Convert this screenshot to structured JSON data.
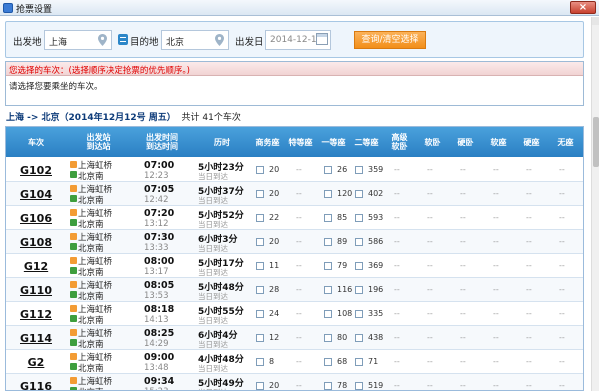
{
  "window": {
    "title": "抢票设置",
    "close_label": "×"
  },
  "query": {
    "from_label": "出发地",
    "from_value": "上海",
    "to_label": "目的地",
    "to_value": "北京",
    "date_label": "出发日",
    "date_value": "2014-12-12",
    "button_label": "查询/清空选择"
  },
  "selected": {
    "header": "您选择的车次：(选择顺序决定抢票的优先顺序。)",
    "prompt": "请选择您要乘坐的车次。"
  },
  "route": {
    "summary": "上海 -> 北京（2014年12月12号 周五）",
    "count_prefix": "共计",
    "count": "41个车次"
  },
  "table": {
    "headers": {
      "train": "车次",
      "station": "出发站\n到达站",
      "time": "出发时间\n到达时间",
      "duration": "历时",
      "business": "商务座",
      "premium": "特等座",
      "first": "一等座",
      "second": "二等座",
      "adv_soft": "高级\n软卧",
      "soft_sleeper": "软卧",
      "hard_sleeper": "硬卧",
      "soft_seat": "软座",
      "hard_seat": "硬座",
      "no_seat": "无座"
    },
    "rows": [
      {
        "train": "G102",
        "from": "上海虹桥",
        "to": "北京南",
        "dep": "07:00",
        "arr": "12:23",
        "dur": "5小时23分",
        "arrday": "当日到达",
        "business": "20",
        "first": "26",
        "second": "359"
      },
      {
        "train": "G104",
        "from": "上海虹桥",
        "to": "北京南",
        "dep": "07:05",
        "arr": "12:42",
        "dur": "5小时37分",
        "arrday": "当日到达",
        "business": "20",
        "first": "120",
        "second": "402"
      },
      {
        "train": "G106",
        "from": "上海虹桥",
        "to": "北京南",
        "dep": "07:20",
        "arr": "13:12",
        "dur": "5小时52分",
        "arrday": "当日到达",
        "business": "22",
        "first": "85",
        "second": "593"
      },
      {
        "train": "G108",
        "from": "上海虹桥",
        "to": "北京南",
        "dep": "07:30",
        "arr": "13:33",
        "dur": "6小时3分",
        "arrday": "当日到达",
        "business": "20",
        "first": "89",
        "second": "586"
      },
      {
        "train": "G12",
        "from": "上海虹桥",
        "to": "北京南",
        "dep": "08:00",
        "arr": "13:17",
        "dur": "5小时17分",
        "arrday": "当日到达",
        "business": "11",
        "first": "79",
        "second": "369"
      },
      {
        "train": "G110",
        "from": "上海虹桥",
        "to": "北京南",
        "dep": "08:05",
        "arr": "13:53",
        "dur": "5小时48分",
        "arrday": "当日到达",
        "business": "28",
        "first": "116",
        "second": "196"
      },
      {
        "train": "G112",
        "from": "上海虹桥",
        "to": "北京南",
        "dep": "08:18",
        "arr": "14:13",
        "dur": "5小时55分",
        "arrday": "当日到达",
        "business": "24",
        "first": "108",
        "second": "335"
      },
      {
        "train": "G114",
        "from": "上海虹桥",
        "to": "北京南",
        "dep": "08:25",
        "arr": "14:29",
        "dur": "6小时4分",
        "arrday": "当日到达",
        "business": "12",
        "first": "80",
        "second": "438"
      },
      {
        "train": "G2",
        "from": "上海虹桥",
        "to": "北京南",
        "dep": "09:00",
        "arr": "13:48",
        "dur": "4小时48分",
        "arrday": "当日到达",
        "business": "8",
        "first": "68",
        "second": "71"
      },
      {
        "train": "G116",
        "from": "上海虹桥",
        "to": "北京南",
        "dep": "09:34",
        "arr": "15:23",
        "dur": "5小时49分",
        "arrday": "当日到达",
        "business": "20",
        "first": "78",
        "second": "519"
      }
    ],
    "empty_mark": "--"
  }
}
